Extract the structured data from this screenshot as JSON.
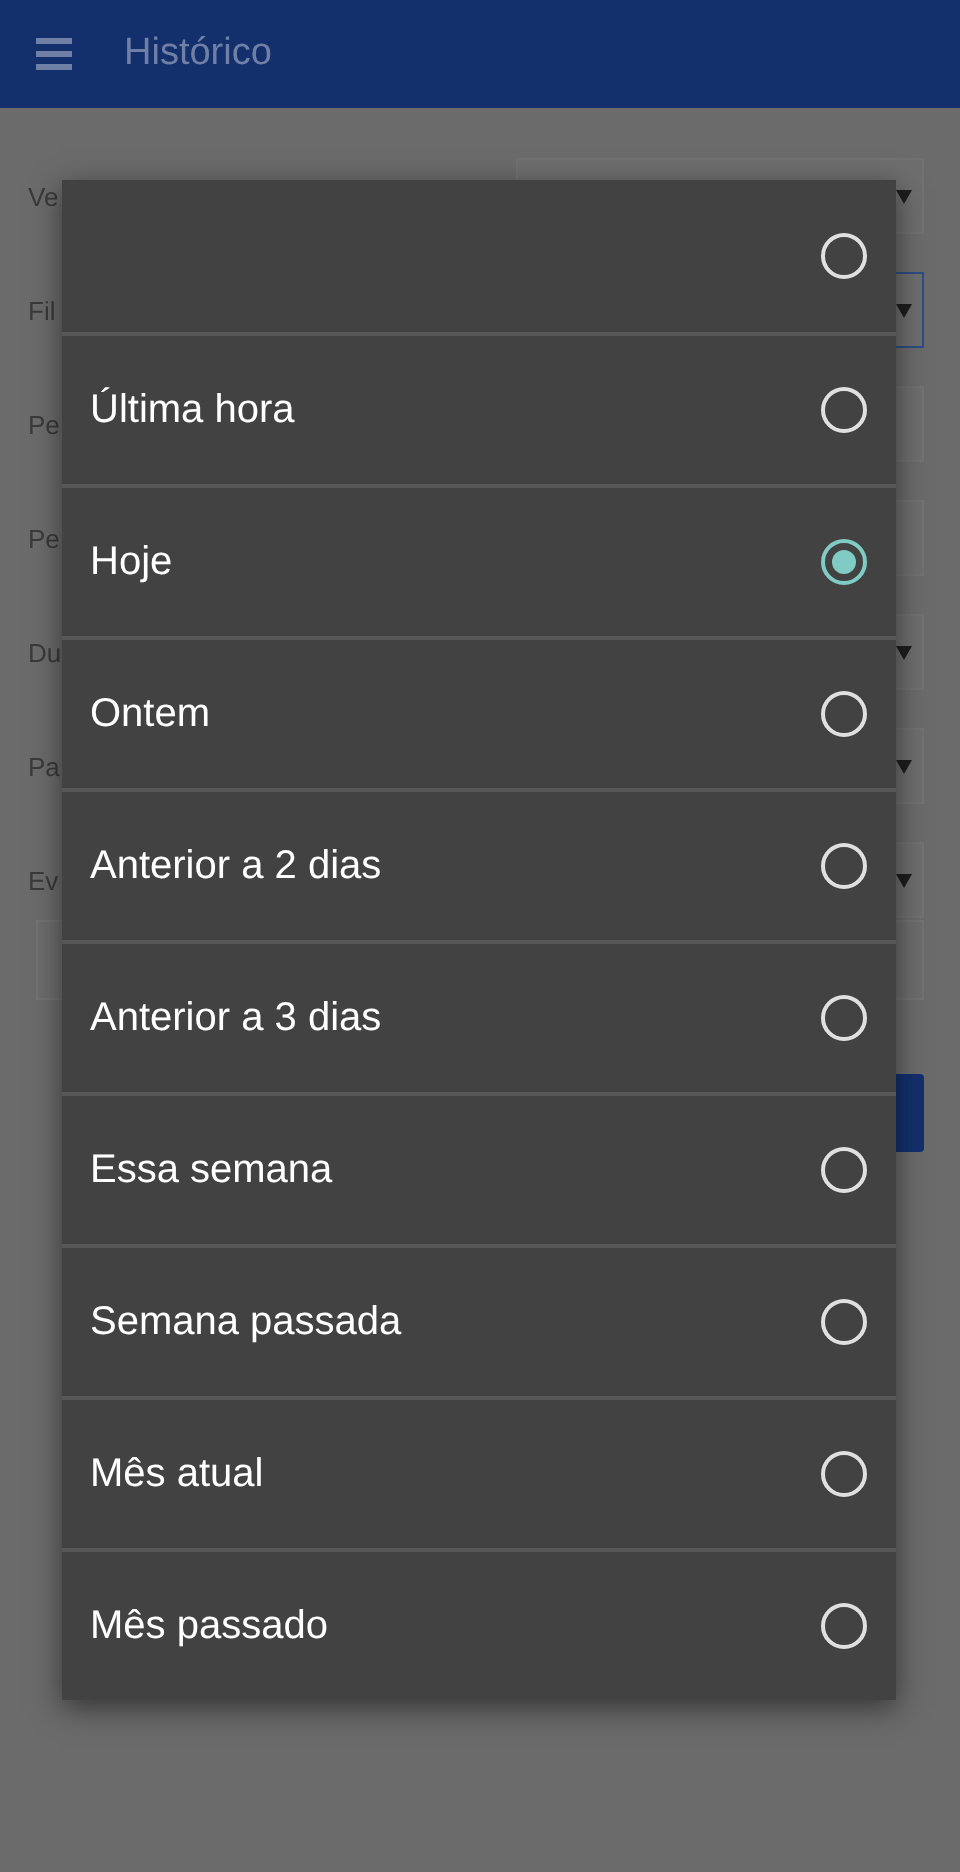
{
  "app_bar": {
    "title": "Histórico"
  },
  "form": {
    "fields": [
      {
        "label": "Ve",
        "kind": "select",
        "focused": false
      },
      {
        "label": "Fil",
        "kind": "select",
        "focused": true
      },
      {
        "label": "Pe",
        "kind": "text",
        "focused": false
      },
      {
        "label": "Pe",
        "kind": "text",
        "focused": false
      },
      {
        "label": "Du",
        "kind": "select",
        "focused": false
      },
      {
        "label": "Pa",
        "kind": "select",
        "focused": false
      },
      {
        "label": "Ev",
        "kind": "select",
        "focused": false
      }
    ]
  },
  "options": [
    {
      "selected": false
    },
    {
      "label": "Última hora",
      "selected": false
    },
    {
      "label": "Hoje",
      "selected": true
    },
    {
      "label": "Ontem",
      "selected": false
    },
    {
      "label": "Anterior a 2 dias",
      "selected": false
    },
    {
      "label": "Anterior a 3 dias",
      "selected": false
    },
    {
      "label": "Essa semana",
      "selected": false
    },
    {
      "label": "Semana passada",
      "selected": false
    },
    {
      "label": "Mês atual",
      "selected": false
    },
    {
      "label": "Mês passado",
      "selected": false
    }
  ]
}
